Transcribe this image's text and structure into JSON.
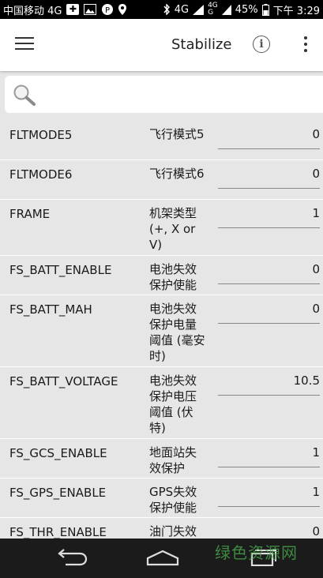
{
  "statusbar": {
    "carrier": "中国移动 4G",
    "network_left": "4G",
    "network_right_top": "4G",
    "network_right_bottom": "G",
    "battery": "45%",
    "time": "下午 3:29"
  },
  "appbar": {
    "title": "Stabilize"
  },
  "search": {
    "placeholder": "",
    "value": ""
  },
  "params": [
    {
      "name": "FLTMODE5",
      "desc": "飞行模式5",
      "value": "0"
    },
    {
      "name": "FLTMODE6",
      "desc": "飞行模式6",
      "value": "0"
    },
    {
      "name": "FRAME",
      "desc": "机架类型(+, X or V)",
      "value": "1"
    },
    {
      "name": "FS_BATT_ENABLE",
      "desc": "电池失效保护使能",
      "value": "0"
    },
    {
      "name": "FS_BATT_MAH",
      "desc": "电池失效保护电量阈值 (毫安时)",
      "value": "0"
    },
    {
      "name": "FS_BATT_VOLTAGE",
      "desc": "电池失效保护电压阈值 (伏特)",
      "value": "10.5"
    },
    {
      "name": "FS_GCS_ENABLE",
      "desc": "地面站失效保护",
      "value": "1"
    },
    {
      "name": "FS_GPS_ENABLE",
      "desc": "GPS失效保护使能",
      "value": "1"
    },
    {
      "name": "FS_THR_ENABLE",
      "desc": "油门失效",
      "value": "0"
    }
  ],
  "watermark": "绿色资源网",
  "colors": {
    "app_bar": "#ffffff",
    "list_bg": "#e6e6e6",
    "status_bar": "#000000",
    "nav_bar": "#1b1b1b"
  }
}
